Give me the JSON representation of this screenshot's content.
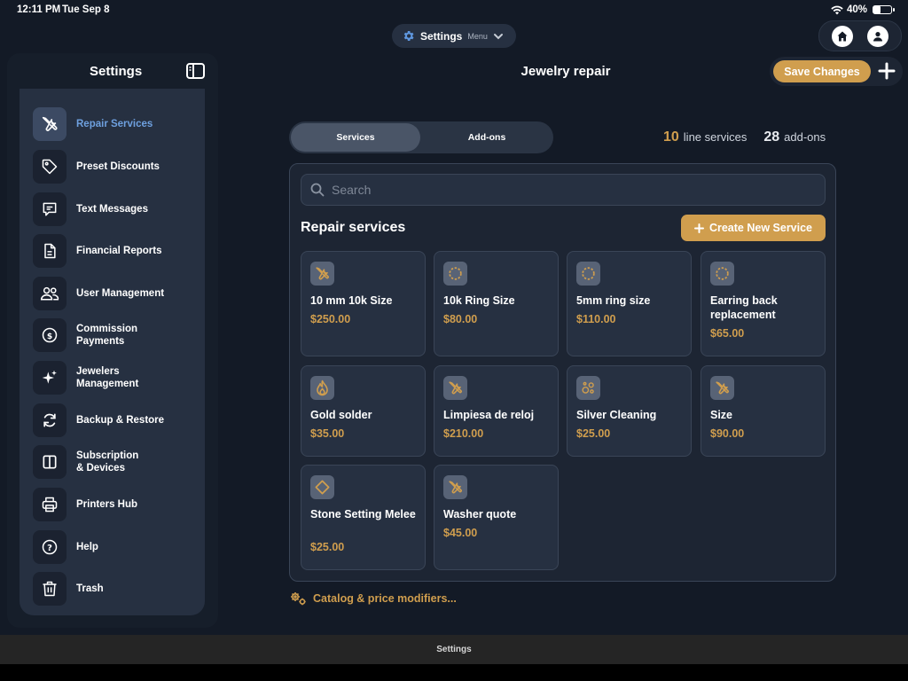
{
  "status_bar": {
    "time": "12:11 PM",
    "date": "Tue Sep 8",
    "battery": "40%",
    "battery_level": 0.4
  },
  "top_menu": {
    "title": "Settings",
    "subtitle": "Menu"
  },
  "sidebar": {
    "title": "Settings",
    "items": [
      {
        "label": "Repair Services",
        "icon": "wrench-screwdriver-icon",
        "active": true
      },
      {
        "label": "Preset Discounts",
        "icon": "tag-icon"
      },
      {
        "label": "Text Messages",
        "icon": "message-icon"
      },
      {
        "label": "Financial Reports",
        "icon": "document-icon"
      },
      {
        "label": "User Management",
        "icon": "users-icon"
      },
      {
        "label": "Commission\nPayments",
        "icon": "dollar-coin-icon"
      },
      {
        "label": "Jewelers\nManagement",
        "icon": "sparkles-icon"
      },
      {
        "label": "Backup & Restore",
        "icon": "refresh-icon"
      },
      {
        "label": "Subscription\n& Devices",
        "icon": "columns-icon"
      },
      {
        "label": "Printers Hub",
        "icon": "printer-icon"
      },
      {
        "label": "Help",
        "icon": "question-icon"
      },
      {
        "label": "Trash",
        "icon": "trash-icon"
      }
    ]
  },
  "header": {
    "title": "Jewelry repair",
    "save_label": "Save Changes"
  },
  "tabs": {
    "services": "Services",
    "addons": "Add-ons",
    "active": "Services"
  },
  "counts": {
    "line_services_num": "10",
    "line_services_label": "line services",
    "addons_num": "28",
    "addons_label": "add-ons"
  },
  "search": {
    "placeholder": "Search"
  },
  "section": {
    "title": "Repair services",
    "create_label": "Create New Service"
  },
  "services": [
    {
      "name": "10 mm 10k Size",
      "price": "$250.00",
      "icon": "wrench-screwdriver-icon"
    },
    {
      "name": "10k Ring Size",
      "price": "$80.00",
      "icon": "dashed-circle-icon"
    },
    {
      "name": "5mm ring size",
      "price": "$110.00",
      "icon": "dashed-circle-icon"
    },
    {
      "name": "Earring back replacement",
      "price": "$65.00",
      "icon": "dashed-circle-icon"
    },
    {
      "name": "Gold solder",
      "price": "$35.00",
      "icon": "flame-icon"
    },
    {
      "name": "Limpiesa de reloj",
      "price": "$210.00",
      "icon": "wrench-screwdriver-icon"
    },
    {
      "name": "Silver Cleaning",
      "price": "$25.00",
      "icon": "bubbles-icon"
    },
    {
      "name": "Size",
      "price": "$90.00",
      "icon": "wrench-screwdriver-icon"
    },
    {
      "name": "Stone Setting Melee",
      "price": "$25.00",
      "icon": "diamond-icon"
    },
    {
      "name": "Washer quote",
      "price": "$45.00",
      "icon": "wrench-screwdriver-icon"
    }
  ],
  "catalog_link": "Catalog & price modifiers...",
  "bottom_tab": "Settings",
  "colors": {
    "accent_gold": "#d09e4e",
    "active_blue": "#6ea0df",
    "background": "#131a26",
    "panel": "#263041"
  }
}
